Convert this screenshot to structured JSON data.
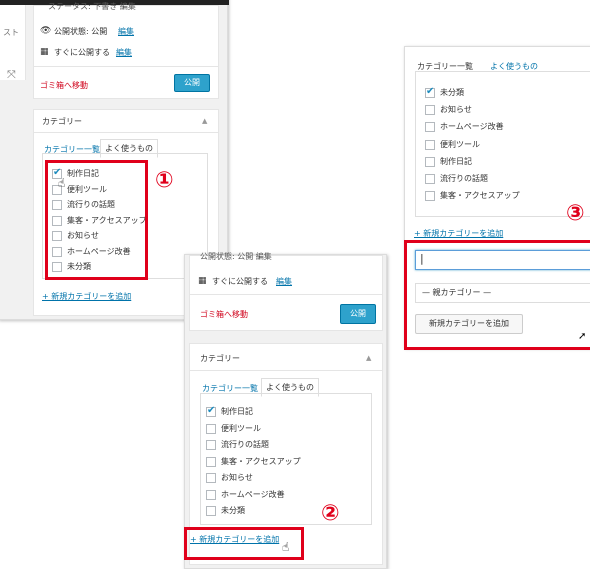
{
  "steps": {
    "one": "①",
    "two": "②",
    "three": "③"
  },
  "panel1": {
    "top_partial": "ステータス: 下書き 編集",
    "top_right_partial": "自動保存: 自動で保存",
    "left_cut_text": "スト",
    "visibility_label": "公開状態: 公開",
    "visibility_edit": "編集",
    "publish_time_label": "すぐに公開する",
    "publish_time_edit": "編集",
    "trash": "ゴミ箱へ移動",
    "publish_button": "公開",
    "category_title": "カテゴリー",
    "tabs": [
      "カテゴリー一覧",
      "よく使うもの"
    ],
    "items": [
      {
        "label": "制作日記",
        "checked": true
      },
      {
        "label": "便利ツール",
        "checked": false
      },
      {
        "label": "流行りの話題",
        "checked": false
      },
      {
        "label": "集客・アクセスアップ",
        "checked": false
      },
      {
        "label": "お知らせ",
        "checked": false
      },
      {
        "label": "ホームページ改善",
        "checked": false
      },
      {
        "label": "未分類",
        "checked": false
      }
    ],
    "add_link": "+ 新規カテゴリーを追加"
  },
  "panel2": {
    "visibility_partial": "公開状態: 公開 編集",
    "publish_time_label": "すぐに公開する",
    "publish_time_edit": "編集",
    "trash": "ゴミ箱へ移動",
    "publish_button": "公開",
    "category_title": "カテゴリー",
    "tabs": [
      "カテゴリー一覧",
      "よく使うもの"
    ],
    "items": [
      {
        "label": "制作日記",
        "checked": true
      },
      {
        "label": "便利ツール",
        "checked": false
      },
      {
        "label": "流行りの話題",
        "checked": false
      },
      {
        "label": "集客・アクセスアップ",
        "checked": false
      },
      {
        "label": "お知らせ",
        "checked": false
      },
      {
        "label": "ホームページ改善",
        "checked": false
      },
      {
        "label": "未分類",
        "checked": false
      }
    ],
    "add_link": "+ 新規カテゴリーを追加"
  },
  "panel3": {
    "tabs": [
      "カテゴリー一覧",
      "よく使うもの"
    ],
    "items": [
      {
        "label": "未分類",
        "checked": true
      },
      {
        "label": "お知らせ",
        "checked": false
      },
      {
        "label": "ホームページ改善",
        "checked": false
      },
      {
        "label": "便利ツール",
        "checked": false
      },
      {
        "label": "制作日記",
        "checked": false
      },
      {
        "label": "流行りの話題",
        "checked": false
      },
      {
        "label": "集客・アクセスアップ",
        "checked": false
      }
    ],
    "add_link": "+ 新規カテゴリーを追加",
    "new_category_value": "",
    "parent_select": "— 親カテゴリー —",
    "add_button": "新規カテゴリーを追加"
  }
}
